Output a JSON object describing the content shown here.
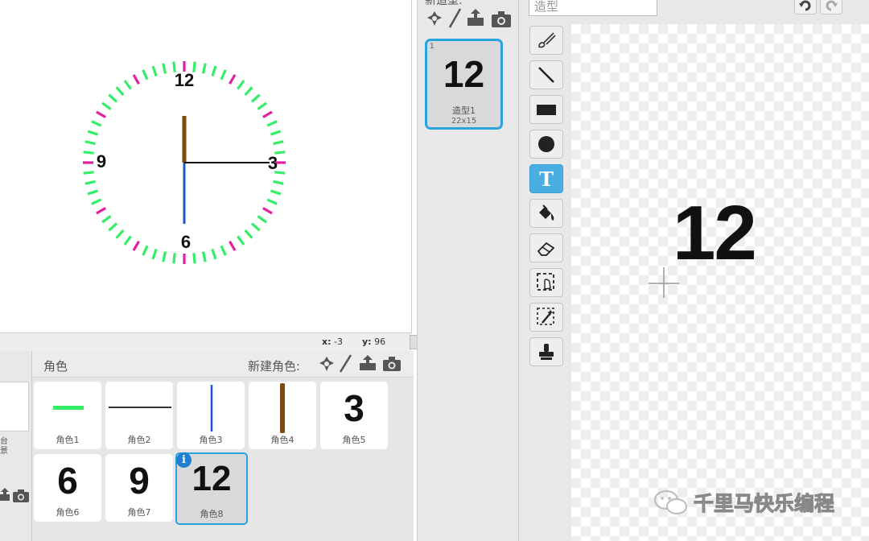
{
  "stage": {
    "clock_numbers": {
      "n12": "12",
      "n3": "3",
      "n6": "6",
      "n9": "9"
    },
    "colors": {
      "tick": "#33ee66",
      "major_tick": "#e020a0",
      "hour_hand": "#7a4a12",
      "minute_hand": "#2255cc",
      "second_hand": "#111111"
    }
  },
  "coords": {
    "x_label": "x:",
    "x_value": "-3",
    "y_label": "y:",
    "y_value": "96"
  },
  "background_panel": {
    "label": "台\n景"
  },
  "sprites": {
    "title": "角色",
    "new_sprite_label": "新建角色:",
    "items": [
      {
        "label": "角色1",
        "kind": "green-line"
      },
      {
        "label": "角色2",
        "kind": "black-line"
      },
      {
        "label": "角色3",
        "kind": "blue-line"
      },
      {
        "label": "角色4",
        "kind": "brown-bar"
      },
      {
        "label": "角色5",
        "number": "3"
      },
      {
        "label": "角色6",
        "number": "6"
      },
      {
        "label": "角色7",
        "number": "9"
      },
      {
        "label": "角色8",
        "number": "12",
        "selected": true,
        "info": "i"
      }
    ]
  },
  "costumes": {
    "new_costume_label": "新造型:",
    "card": {
      "index": "1",
      "number": "12",
      "name": "造型1",
      "size": "22x15"
    }
  },
  "editor": {
    "name_value": "造型",
    "canvas_text": "12",
    "tools": [
      "brush-icon",
      "line-icon",
      "rectangle-icon",
      "ellipse-icon",
      "text-icon",
      "fill-icon",
      "eraser-icon",
      "select-icon",
      "magic-wand-icon",
      "stamp-icon"
    ],
    "active_tool": "text-icon",
    "text_tool_glyph": "T"
  },
  "watermark": {
    "text": "千里马快乐编程"
  }
}
